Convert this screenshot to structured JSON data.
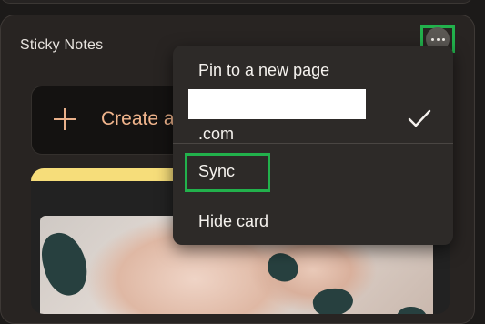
{
  "panel": {
    "title": "Sticky Notes",
    "more_icon": "more-horizontal-icon"
  },
  "create_note": {
    "icon": "plus-icon",
    "label": "Create a"
  },
  "menu": {
    "items": [
      {
        "label": "Pin to a new page"
      },
      {
        "label": ".com",
        "checked": true,
        "redacted": true
      },
      {
        "label": "Sync",
        "highlighted": true
      },
      {
        "label": "Hide card"
      }
    ]
  },
  "colors": {
    "accent": "#f0b48c",
    "highlight": "#22b14c",
    "note_strip": "#f6dd7a",
    "menu_bg": "#2d2a28"
  }
}
